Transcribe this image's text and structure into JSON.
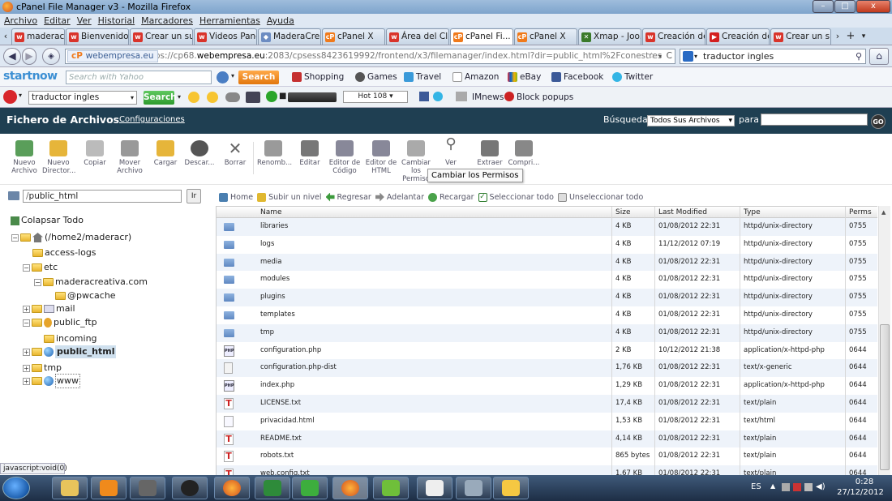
{
  "window": {
    "title": "cPanel File Manager v3 - Mozilla Firefox",
    "minimize": "–",
    "maximize": "□",
    "close": "x"
  },
  "menu": [
    "Archivo",
    "Editar",
    "Ver",
    "Historial",
    "Marcadores",
    "Herramientas",
    "Ayuda"
  ],
  "tabs": [
    {
      "label": "maderacrea...",
      "fav": "w",
      "color": "#d9342b"
    },
    {
      "label": "Bienvenido ...",
      "fav": "w",
      "color": "#d9342b"
    },
    {
      "label": "Crear un su...",
      "fav": "w",
      "color": "#d9342b"
    },
    {
      "label": "Videos Pane...",
      "fav": "w",
      "color": "#d9342b"
    },
    {
      "label": "MaderaCrea...",
      "fav": "◆",
      "color": "#6c8cc2"
    },
    {
      "label": "cPanel X",
      "fav": "cP",
      "color": "#f07a1b"
    },
    {
      "label": "Área del Cli...",
      "fav": "w",
      "color": "#d9342b"
    },
    {
      "label": "cPanel Fi...",
      "fav": "cP",
      "color": "#f07a1b",
      "active": true
    },
    {
      "label": "cPanel X",
      "fav": "cP",
      "color": "#f07a1b"
    },
    {
      "label": "Xmap - Joo...",
      "fav": "✕",
      "color": "#3a7a2a"
    },
    {
      "label": "Creación de...",
      "fav": "w",
      "color": "#d9342b"
    },
    {
      "label": "Creación de...",
      "fav": "▶",
      "color": "#d31f1f"
    },
    {
      "label": "Crear un su...",
      "fav": "w",
      "color": "#d9342b"
    }
  ],
  "nav": {
    "site": "webempresa.eu",
    "url_pre": "https://cp68.",
    "url_domain": "webempresa.eu",
    "url_post": ":2083/cpsess8423619992/frontend/x3/filemanager/index.html?dir=public_html%2Fconestres",
    "search": "traductor ingles"
  },
  "toolbar1": {
    "brand": "startnow",
    "search_placeholder": "Search with Yahoo",
    "search_btn": "Search",
    "links": [
      "Shopping",
      "Games",
      "Travel",
      "Amazon",
      "eBay",
      "Facebook",
      "Twitter"
    ]
  },
  "toolbar2": {
    "query": "traductor ingles",
    "search_btn": "Search",
    "ticker": "Hot 108 ▾",
    "links": [
      "IMnews",
      "Block popups"
    ]
  },
  "header": {
    "title": "Fichero de Archivos",
    "settings": "Configuraciones",
    "search_label": "Búsqueda",
    "search_scope": "Todos Sus Archivos",
    "para": "para",
    "go": "GO"
  },
  "tools": [
    "Nuevo Archivo",
    "Nuevo Director...",
    "Copiar",
    "Mover Archivo",
    "Cargar",
    "Descar...",
    "Borrar",
    "Renomb...",
    "Editar",
    "Editor de Código",
    "Editor de HTML",
    "Cambiar los Permiso",
    "Ver",
    "Extraer",
    "Compri..."
  ],
  "tooltip": "Cambiar los Permisos",
  "path": {
    "value": "public_html",
    "go": "Ir"
  },
  "tree": {
    "collapse": "Colapsar Todo",
    "root": "(/home2/maderacr)",
    "items": [
      "access-logs",
      "etc",
      "maderacreativa.com",
      "@pwcache",
      "mail",
      "public_ftp",
      "incoming",
      "public_html",
      "tmp",
      "www"
    ]
  },
  "actions": [
    "Home",
    "Subir un nivel",
    "Regresar",
    "Adelantar",
    "Recargar",
    "Seleccionar todo",
    "Unseleccionar todo"
  ],
  "columns": [
    "Name",
    "Size",
    "Last Modified",
    "Type",
    "Perms"
  ],
  "files": [
    {
      "icon": "folder",
      "name": "libraries",
      "size": "4 KB",
      "modified": "01/08/2012 22:31",
      "type": "httpd/unix-directory",
      "perms": "0755"
    },
    {
      "icon": "folder",
      "name": "logs",
      "size": "4 KB",
      "modified": "11/12/2012 07:19",
      "type": "httpd/unix-directory",
      "perms": "0755"
    },
    {
      "icon": "folder",
      "name": "media",
      "size": "4 KB",
      "modified": "01/08/2012 22:31",
      "type": "httpd/unix-directory",
      "perms": "0755"
    },
    {
      "icon": "folder",
      "name": "modules",
      "size": "4 KB",
      "modified": "01/08/2012 22:31",
      "type": "httpd/unix-directory",
      "perms": "0755"
    },
    {
      "icon": "folder",
      "name": "plugins",
      "size": "4 KB",
      "modified": "01/08/2012 22:31",
      "type": "httpd/unix-directory",
      "perms": "0755"
    },
    {
      "icon": "folder",
      "name": "templates",
      "size": "4 KB",
      "modified": "01/08/2012 22:31",
      "type": "httpd/unix-directory",
      "perms": "0755"
    },
    {
      "icon": "folder",
      "name": "tmp",
      "size": "4 KB",
      "modified": "01/08/2012 22:31",
      "type": "httpd/unix-directory",
      "perms": "0755"
    },
    {
      "icon": "php",
      "name": "configuration.php",
      "size": "2 KB",
      "modified": "10/12/2012 21:38",
      "type": "application/x-httpd-php",
      "perms": "0644"
    },
    {
      "icon": "generic",
      "name": "configuration.php-dist",
      "size": "1,76 KB",
      "modified": "01/08/2012 22:31",
      "type": "text/x-generic",
      "perms": "0644"
    },
    {
      "icon": "php",
      "name": "index.php",
      "size": "1,29 KB",
      "modified": "01/08/2012 22:31",
      "type": "application/x-httpd-php",
      "perms": "0644"
    },
    {
      "icon": "text",
      "name": "LICENSE.txt",
      "size": "17,4 KB",
      "modified": "01/08/2012 22:31",
      "type": "text/plain",
      "perms": "0644"
    },
    {
      "icon": "html",
      "name": "privacidad.html",
      "size": "1,53 KB",
      "modified": "01/08/2012 22:31",
      "type": "text/html",
      "perms": "0644"
    },
    {
      "icon": "text",
      "name": "README.txt",
      "size": "4,14 KB",
      "modified": "01/08/2012 22:31",
      "type": "text/plain",
      "perms": "0644"
    },
    {
      "icon": "text",
      "name": "robots.txt",
      "size": "865 bytes",
      "modified": "01/08/2012 22:31",
      "type": "text/plain",
      "perms": "0644"
    },
    {
      "icon": "text",
      "name": "web.config.txt",
      "size": "1,67 KB",
      "modified": "01/08/2012 22:31",
      "type": "text/plain",
      "perms": "0644"
    }
  ],
  "statusbar": "javascript:void(0)",
  "tray": {
    "lang": "ES",
    "time": "0:28",
    "date": "27/12/2012"
  }
}
